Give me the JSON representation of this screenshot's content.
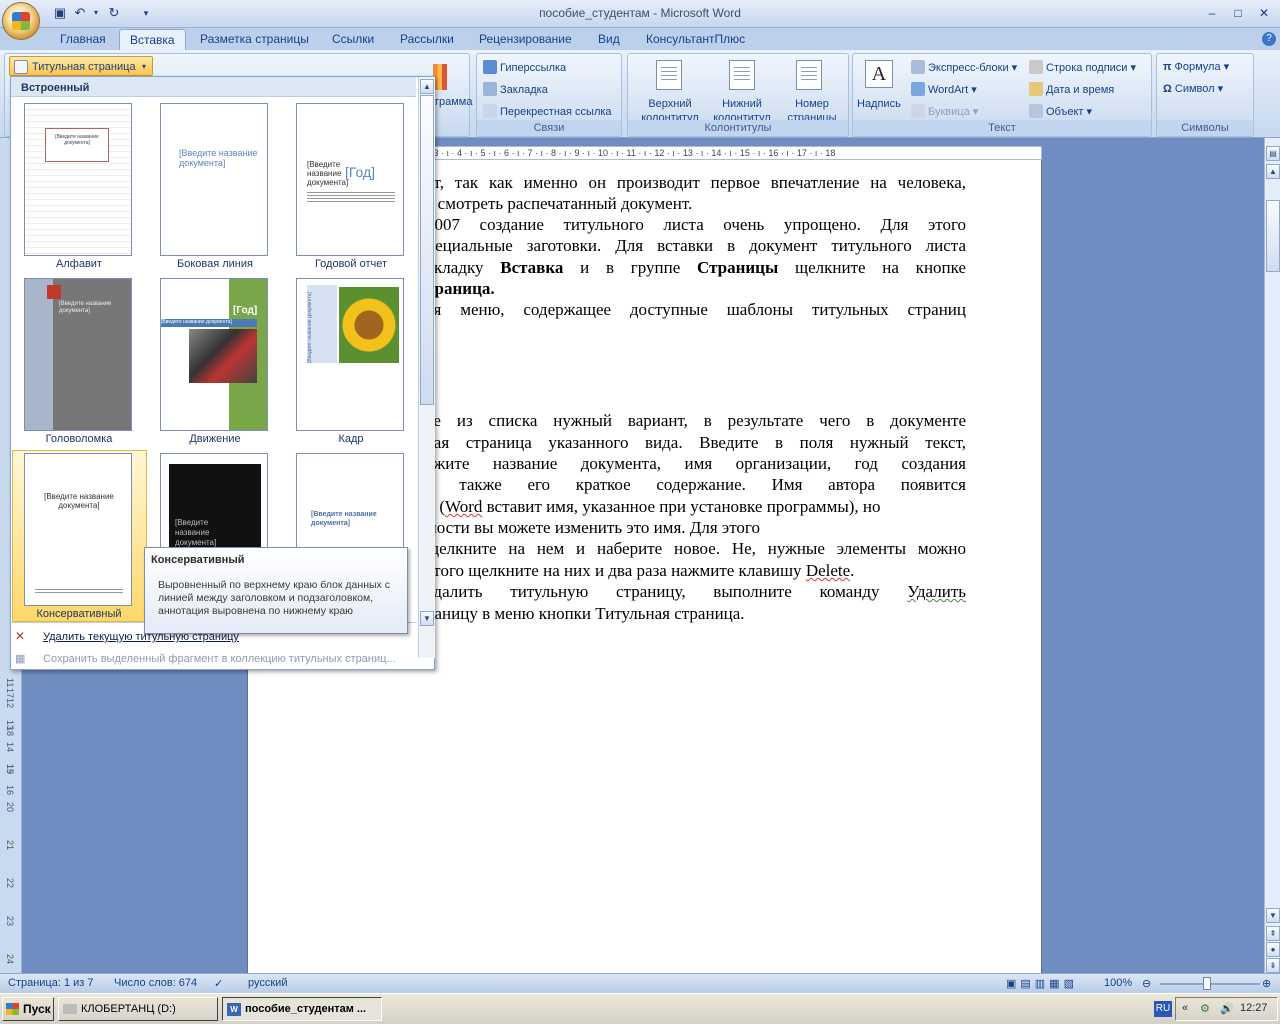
{
  "window": {
    "title": "пособие_студентам - Microsoft Word",
    "controls": [
      "–",
      "□",
      "✕"
    ]
  },
  "qat": [
    "save-icon",
    "undo-icon",
    "redo-icon",
    "customize-icon"
  ],
  "tabs": [
    "Главная",
    "Вставка",
    "Разметка страницы",
    "Ссылки",
    "Рассылки",
    "Рецензирование",
    "Вид",
    "КонсультантПлюс"
  ],
  "active_tab": "Вставка",
  "ribbon": {
    "cover_page_btn": "Титульная страница",
    "diagram_fragment": "грамма",
    "links": {
      "hyperlink": "Гиперссылка",
      "bookmark": "Закладка",
      "cross_ref": "Перекрестная ссылка",
      "label": "Связи"
    },
    "headers": {
      "header": "Верхний колонтитул",
      "footer": "Нижний колонтитул",
      "page_number": "Номер страницы",
      "label": "Колонтитулы"
    },
    "text": {
      "textbox": "Надпись",
      "quickparts": "Экспресс-блоки",
      "wordart": "WordArt",
      "dropcap": "Буквица",
      "sigline": "Строка подписи",
      "datetime": "Дата и время",
      "object": "Объект",
      "label": "Текст"
    },
    "symbols": {
      "equation": "Формула",
      "symbol": "Символ",
      "label": "Символы"
    }
  },
  "gallery": {
    "heading": "Встроенный",
    "templates": [
      {
        "name": "Алфавит"
      },
      {
        "name": "Боковая линия"
      },
      {
        "name": "Годовой отчет"
      },
      {
        "name": "Головоломка"
      },
      {
        "name": "Движение"
      },
      {
        "name": "Кадр"
      },
      {
        "name": "Консервативный"
      }
    ],
    "thumb_texts": {
      "title": "[Введите название документа]",
      "year": "[Год]",
      "short_title": "[Введите название документа]",
      "year_short": "[Год]"
    },
    "remove_item": "Удалить текущую титульную страницу",
    "save_item": "Сохранить выделенный фрагмент в коллекцию титульных страниц..."
  },
  "tooltip": {
    "title": "Консервативный",
    "body": "Выровненный по верхнему краю блок данных с линией между заголовком и подзаголовком, аннотация выровнена по нижнему краю"
  },
  "ruler": "· 3 · ı · 4 · ı · 5 · ı · 6 · ı · 7 · ı · 8 · ı · 9 · ı · 10 · ı · 11 · ı · 12 · ı · 13 · ı · 14 · ı · 15 · ı · 16 · ı · 17 · ı · 18",
  "vruler_nums": [
    "11",
    "12",
    "13",
    "14",
    "15",
    "16",
    "17",
    "18",
    "19",
    "20",
    "21",
    "22",
    "23",
    "24"
  ],
  "document": {
    "l1": "ст, так как именно он производит первое впечатление на человека,",
    "l2": "т смотреть распечатанный документ.",
    "l3": "2007 создание титульного листа очень упрощено. Для этого",
    "l4": "пециальные заготовки. Для вставки в документ титульного листа",
    "l5a": "вкладку",
    "l5b": "Вставка",
    "l5c": "и в группе",
    "l5d": "Страницы",
    "l5e": "щелкните на кнопке",
    "l6": "траница.",
    "l7": "ся меню, содержащее доступные шаблоны титульных страниц",
    "l8": "те из списка нужный вариант, в результате чего в документе",
    "l9": "вая страница указанного вида. Введите в поля нужный текст,",
    "l10": "ажите название документа, имя организации, год создания",
    "l11": "а также его краткое содержание. Имя автора появится",
    "l12a": "и (",
    "l12b": "Word",
    "l12c": " вставит имя, указанное при установке программы), но",
    "l13": "мости вы можете изменить это имя. Для этого",
    "l14": "щелкните на нем и наберите новое. Не, нужные элементы можно",
    "l15a": "этого щелкните на них и два раза нажмите клавишу ",
    "l15b": "Delete",
    ".": ".",
    "l16a": "удалить титульную страницу, выполните команду ",
    "l16b": "Удалить",
    "l17": "раницу в меню кнопки Титульная страница."
  },
  "status": {
    "page": "Страница: 1 из 7",
    "words": "Число слов: 674",
    "lang": "русский",
    "zoom": "100%"
  },
  "taskbar": {
    "start": "Пуск",
    "tasks": [
      "КЛОБЕРТАНЦ (D:)",
      "пособие_студентам ..."
    ],
    "lang": "RU",
    "time": "12:27"
  }
}
